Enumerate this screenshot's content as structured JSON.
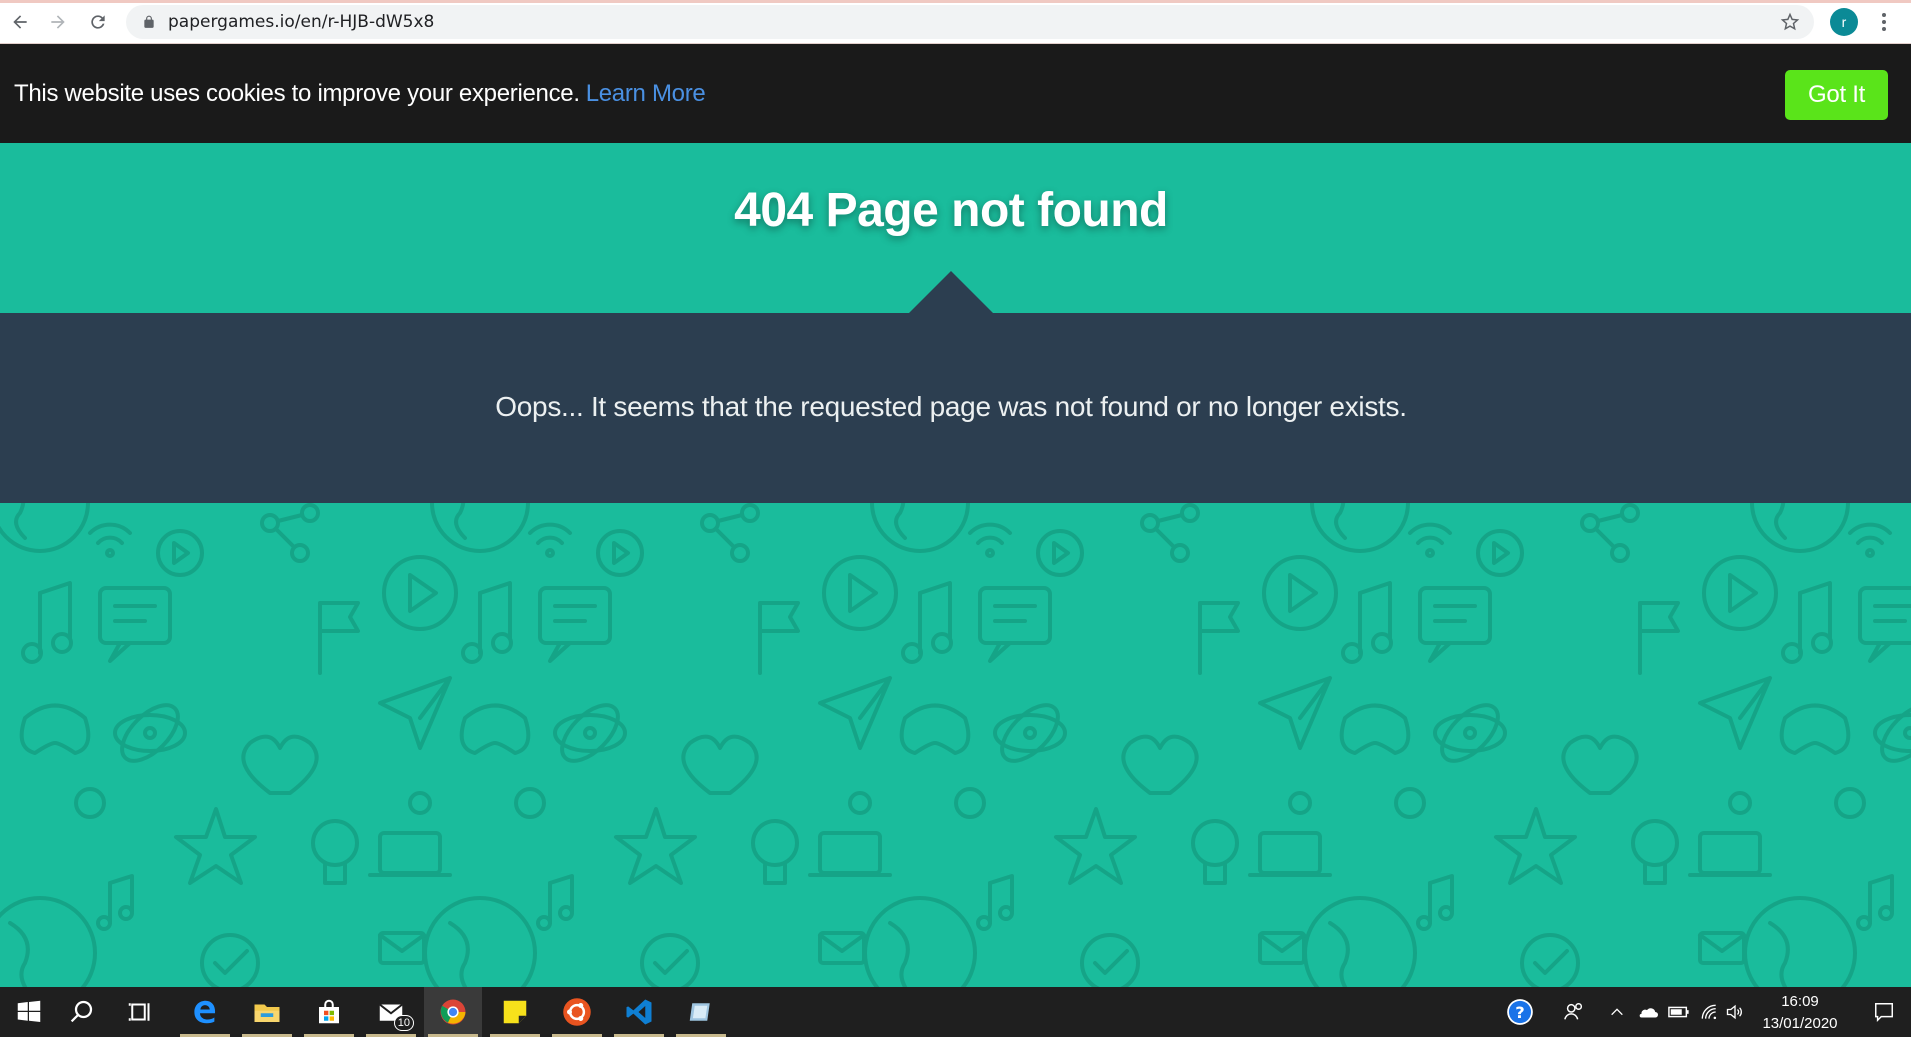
{
  "browser": {
    "url": "papergames.io/en/r-HJB-dW5x8",
    "avatar_letter": "r",
    "avatar_color": "#0b8a96"
  },
  "cookie_banner": {
    "message": "This website uses cookies to improve your experience.",
    "link_label": "Learn More",
    "accept_label": "Got It",
    "accept_color": "#5ae41a",
    "link_color": "#4a90e2"
  },
  "page": {
    "title": "404 Page not found",
    "message": "Oops... It seems that the requested page was not found or no longer exists.",
    "accent_color": "#1abc9c",
    "band_color": "#2c3e50"
  },
  "taskbar": {
    "items": [
      {
        "name": "start-icon"
      },
      {
        "name": "search-icon"
      },
      {
        "name": "task-view-icon"
      },
      {
        "name": "edge-icon"
      },
      {
        "name": "file-explorer-icon"
      },
      {
        "name": "store-icon"
      },
      {
        "name": "mail-icon",
        "badge": "10"
      },
      {
        "name": "chrome-icon"
      },
      {
        "name": "sticky-notes-icon"
      },
      {
        "name": "ubuntu-icon"
      },
      {
        "name": "vscode-icon"
      },
      {
        "name": "app-icon"
      }
    ],
    "tray": [
      "help-icon",
      "people-icon",
      "chevron-up-icon",
      "onedrive-icon",
      "battery-icon",
      "wifi-icon",
      "volume-icon"
    ],
    "time": "16:09",
    "date": "13/01/2020"
  }
}
